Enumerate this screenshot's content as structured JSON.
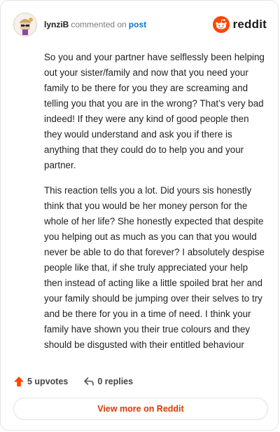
{
  "header": {
    "username": "lynziB",
    "action_text": "commented on",
    "post_link": "post",
    "logo_text": "reddit",
    "brand_color": "#ff4500"
  },
  "comment": {
    "paragraphs": [
      "So you and your partner have selflessly been helping out your sister/family and now that you need your family to be there for you they are screaming and telling you that you are in the wrong? That’s very bad indeed! If they were any kind of good people then they would understand and ask you if there is anything that they could do to help you and your partner.",
      "This reaction tells you a lot. Did yours sis honestly think that you would be her money person for the whole of her life? She honestly expected that despite you helping out as much as you can that you would never be able to do that forever? I absolutely despise people like that, if she truly appreciated your help then instead of acting like a little spoiled brat her and your family should be jumping over their selves to try and be there for you in a time of need. I think your family have shown you their true colours and they should be disgusted with their entitled behaviour"
    ]
  },
  "footer": {
    "upvotes": "5 upvotes",
    "replies": "0 replies",
    "upvote_icon": "upvote-arrow-icon",
    "reply_icon": "reply-arrow-icon",
    "upvote_color": "#ff4500"
  },
  "view_more": {
    "label": "View more on Reddit",
    "color": "#d93a00"
  }
}
